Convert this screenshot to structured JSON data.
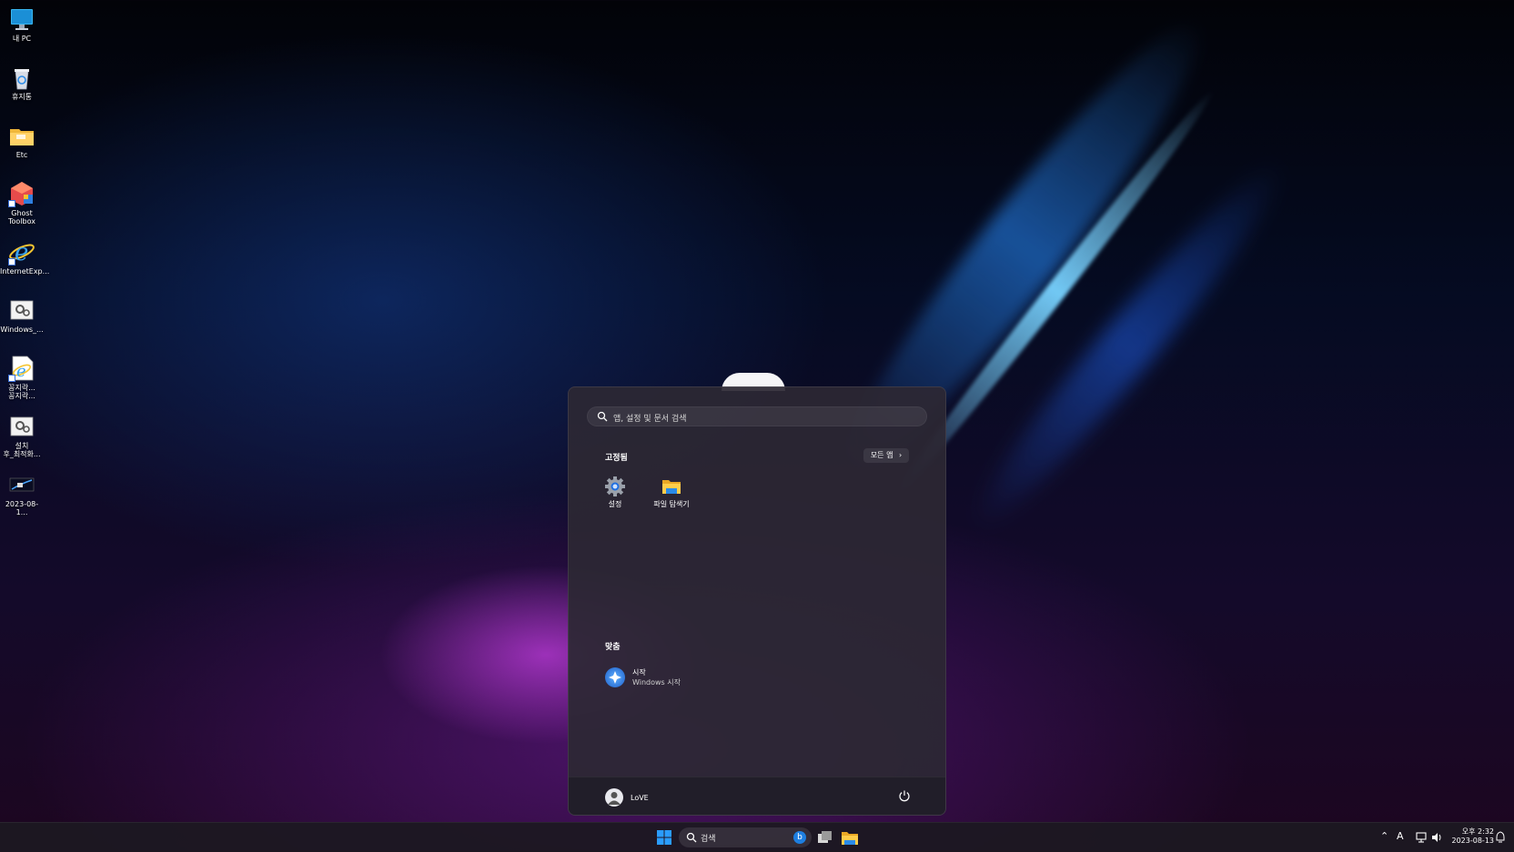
{
  "desktop": {
    "icons": [
      {
        "label": "내 PC",
        "icon": "monitor-icon"
      },
      {
        "label": "휴지통",
        "icon": "recycle-bin-icon"
      },
      {
        "label": "Etc",
        "icon": "folder-icon"
      },
      {
        "label": "Ghost\nToolbox",
        "icon": "ghost-toolbox-icon"
      },
      {
        "label": "InternetExp...",
        "icon": "internet-explorer-icon"
      },
      {
        "label": "Windows_...",
        "icon": "settings-script-icon"
      },
      {
        "label": "꽁지락...\n꽁지락...",
        "icon": "ie-shortcut-icon"
      },
      {
        "label": "설치\n후_최적화...",
        "icon": "settings-script-icon"
      },
      {
        "label": "2023-08-1...",
        "icon": "image-file-icon"
      }
    ]
  },
  "start_menu": {
    "search_placeholder": "앱, 설정 및 문서 검색",
    "pinned_title": "고정됨",
    "all_apps_label": "모든 앱",
    "pinned": [
      {
        "label": "설정",
        "icon": "settings-gear-icon"
      },
      {
        "label": "파일 탐색기",
        "icon": "file-explorer-icon"
      }
    ],
    "recommended_title": "맞춤",
    "recommended": [
      {
        "title": "시작",
        "subtitle": "Windows 시작",
        "icon": "get-started-icon"
      }
    ],
    "user_name": "LoVE"
  },
  "taskbar": {
    "search_placeholder": "검색",
    "tray_lang": "A",
    "clock_time": "오후 2:32",
    "clock_date": "2023-08-13"
  },
  "colors": {
    "accent": "#1e90ff",
    "start_bg": "#2c2834",
    "taskbar_bg": "#1c1822"
  }
}
